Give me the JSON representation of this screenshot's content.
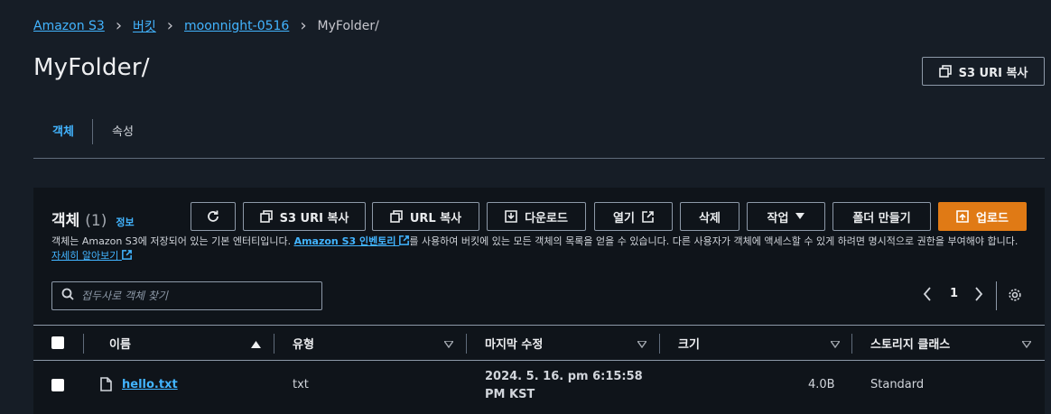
{
  "breadcrumb": {
    "items": [
      "Amazon S3",
      "버킷",
      "moonnight-0516"
    ],
    "current": "MyFolder/"
  },
  "page": {
    "title": "MyFolder/",
    "copy_s3_uri_label": "S3 URI 복사"
  },
  "tabs": [
    {
      "label": "객체",
      "active": true
    },
    {
      "label": "속성",
      "active": false
    }
  ],
  "objects_panel": {
    "title": "객체",
    "count": "(1)",
    "info_link": "정보",
    "description_pre": "객체는 Amazon S3에 저장되어 있는 기본 엔터티입니다. ",
    "inventory_link": "Amazon S3 인벤토리",
    "description_post": "를 사용하여 버킷에 있는 모든 객체의 목록을 얻을 수 있습니다. 다른 사용자가 객체에 액세스할 수 있게 하려면 명시적으로 권한을 부여해야 합니다.",
    "learn_more_link": "자세히 알아보기",
    "search_placeholder": "접두사로 객체 찾기",
    "page_number": "1"
  },
  "toolbar": {
    "refresh_label": "",
    "copy_s3_uri_label": "S3 URI 복사",
    "copy_url_label": "URL 복사",
    "download_label": "다운로드",
    "open_label": "열기",
    "delete_label": "삭제",
    "actions_label": "작업",
    "create_folder_label": "폴더 만들기",
    "upload_label": "업로드"
  },
  "table": {
    "columns": [
      "이름",
      "유형",
      "마지막 수정",
      "크기",
      "스토리지 클래스"
    ],
    "rows": [
      {
        "name": "hello.txt",
        "type": "txt",
        "last_modified_line1": "2024. 5. 16. pm 6:15:58",
        "last_modified_line2": "PM KST",
        "size": "4.0B",
        "storage_class": "Standard"
      }
    ]
  },
  "colors": {
    "background": "#161d26",
    "panel": "#0f141a",
    "link": "#42b4ff",
    "primary": "#e07a15"
  }
}
